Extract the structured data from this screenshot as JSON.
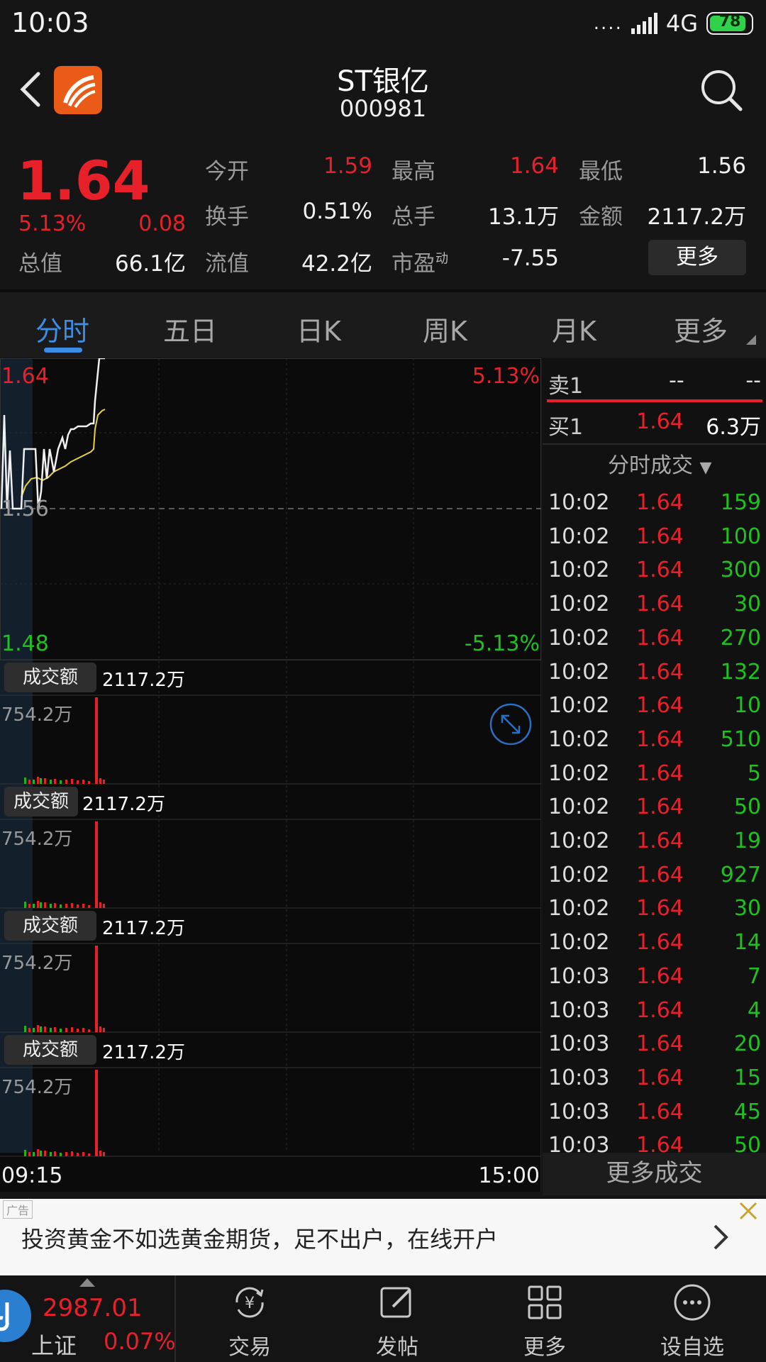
{
  "status_bar": {
    "time": "10:03",
    "signal": "....",
    "network": "4G",
    "battery": "78"
  },
  "header": {
    "title": "ST银亿",
    "code": "000981"
  },
  "quote": {
    "price": "1.64",
    "change_pct": "5.13%",
    "change": "0.08",
    "fields": [
      {
        "label": "今开",
        "value": "1.59",
        "color": "red"
      },
      {
        "label": "最高",
        "value": "1.64",
        "color": "red"
      },
      {
        "label": "最低",
        "value": "1.56",
        "color": "white"
      },
      {
        "label": "换手",
        "value": "0.51%",
        "color": "white"
      },
      {
        "label": "总手",
        "value": "13.1万",
        "color": "white"
      },
      {
        "label": "金额",
        "value": "2117.2万",
        "color": "white"
      },
      {
        "label": "总值",
        "value": "66.1亿",
        "color": "white"
      },
      {
        "label": "流值",
        "value": "42.2亿",
        "color": "white"
      },
      {
        "label": "市盈",
        "value": "-7.55",
        "color": "white"
      }
    ],
    "pe_superscript": "动",
    "more_button": "更多"
  },
  "tabs": [
    "分时",
    "五日",
    "日K",
    "周K",
    "月K",
    "更多"
  ],
  "active_tab": "分时",
  "chart": {
    "price_high": "1.64",
    "pct_high": "5.13%",
    "price_mid": "1.56",
    "price_low": "1.48",
    "pct_low": "-5.13%",
    "time_start": "09:15",
    "time_end": "15:00",
    "volume_panels": [
      {
        "label": "成交额",
        "value": "2117.2万",
        "max": "754.2万"
      },
      {
        "label": "成交额",
        "value": "2117.2万",
        "max": "754.2万"
      },
      {
        "label": "成交额",
        "value": "2117.2万",
        "max": "754.2万"
      },
      {
        "label": "成交额",
        "value": "2117.2万",
        "max": "754.2万"
      }
    ]
  },
  "orderbook": {
    "sell1": {
      "label": "卖1",
      "price": "--",
      "volume": "--"
    },
    "buy1": {
      "label": "买1",
      "price": "1.64",
      "volume": "6.3万"
    }
  },
  "trades_header": "分时成交",
  "trades": [
    {
      "time": "10:02",
      "price": "1.64",
      "volume": "159"
    },
    {
      "time": "10:02",
      "price": "1.64",
      "volume": "100"
    },
    {
      "time": "10:02",
      "price": "1.64",
      "volume": "300"
    },
    {
      "time": "10:02",
      "price": "1.64",
      "volume": "30"
    },
    {
      "time": "10:02",
      "price": "1.64",
      "volume": "270"
    },
    {
      "time": "10:02",
      "price": "1.64",
      "volume": "132"
    },
    {
      "time": "10:02",
      "price": "1.64",
      "volume": "10"
    },
    {
      "time": "10:02",
      "price": "1.64",
      "volume": "510"
    },
    {
      "time": "10:02",
      "price": "1.64",
      "volume": "5"
    },
    {
      "time": "10:02",
      "price": "1.64",
      "volume": "50"
    },
    {
      "time": "10:02",
      "price": "1.64",
      "volume": "19"
    },
    {
      "time": "10:02",
      "price": "1.64",
      "volume": "927"
    },
    {
      "time": "10:02",
      "price": "1.64",
      "volume": "30"
    },
    {
      "time": "10:02",
      "price": "1.64",
      "volume": "14"
    },
    {
      "time": "10:03",
      "price": "1.64",
      "volume": "7"
    },
    {
      "time": "10:03",
      "price": "1.64",
      "volume": "4"
    },
    {
      "time": "10:03",
      "price": "1.64",
      "volume": "20"
    },
    {
      "time": "10:03",
      "price": "1.64",
      "volume": "15"
    },
    {
      "time": "10:03",
      "price": "1.64",
      "volume": "45"
    },
    {
      "time": "10:03",
      "price": "1.64",
      "volume": "50"
    }
  ],
  "more_trades": "更多成交",
  "ad": {
    "tag": "广告",
    "text": "投资黄金不如选黄金期货，足不出户，在线开户"
  },
  "bottom_nav": {
    "index_value": "2987.01",
    "index_name": "上证",
    "index_pct": "0.07%",
    "items": [
      "交易",
      "发帖",
      "更多",
      "设自选"
    ]
  }
}
